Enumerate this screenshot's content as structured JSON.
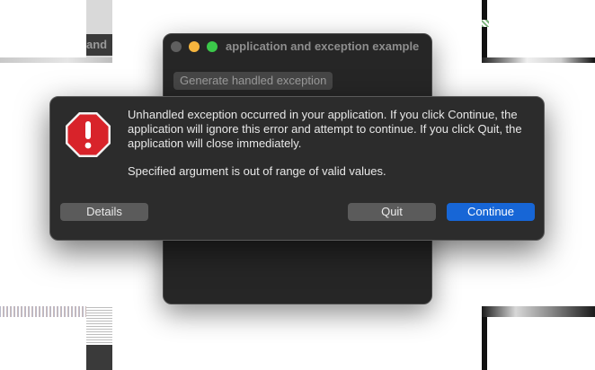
{
  "app_window": {
    "title": "application and exception example",
    "generate_button_label": "Generate handled exception"
  },
  "background_fragment": {
    "partial_title": "and"
  },
  "dialog": {
    "icon": "stop-octagon-exclamation-icon",
    "message": "Unhandled exception occurred in your application. If you click Continue, the application will ignore this error and attempt to continue. If you click Quit, the application will close immediately.",
    "detail": "Specified argument is out of range of valid values.",
    "buttons": {
      "details": "Details",
      "quit": "Quit",
      "continue": "Continue"
    }
  },
  "colors": {
    "accent": "#1766d6",
    "alert_red": "#d8232a",
    "traffic_close": "#5f5f5f",
    "traffic_minimize": "#f6b53e",
    "traffic_maximize": "#3bc84a"
  }
}
